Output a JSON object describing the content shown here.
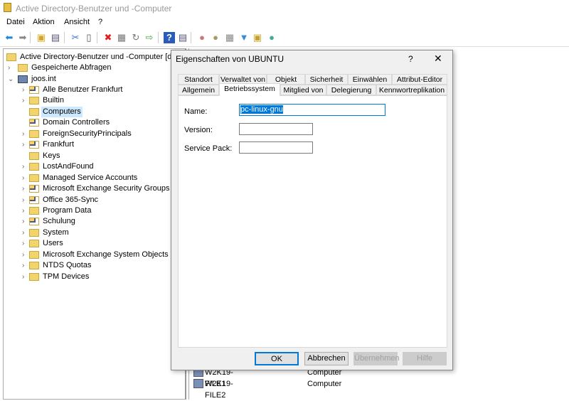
{
  "window": {
    "title": "Active Directory-Benutzer und -Computer"
  },
  "menu": [
    "Datei",
    "Aktion",
    "Ansicht",
    "?"
  ],
  "toolbar": {
    "icons": [
      "back-icon",
      "forward-icon",
      "up-folder-icon",
      "show-tree-icon",
      "cut-icon",
      "paste-icon",
      "delete-icon",
      "properties-icon",
      "refresh-icon",
      "export-icon",
      "help-icon",
      "console-icon",
      "new-user-icon",
      "new-group-icon",
      "new-ou-icon",
      "filter-icon",
      "add-to-group-icon",
      "delegate-icon"
    ]
  },
  "tree": {
    "root": "Active Directory-Benutzer und -Computer [dc0",
    "saved": "Gespeicherte Abfragen",
    "domain": "joos.int",
    "children": [
      {
        "label": "Alle Benutzer Frankfurt",
        "chev": true,
        "ou": true
      },
      {
        "label": "Builtin",
        "chev": true,
        "ou": false
      },
      {
        "label": "Computers",
        "chev": false,
        "ou": false,
        "selected": true
      },
      {
        "label": "Domain Controllers",
        "chev": false,
        "ou": true
      },
      {
        "label": "ForeignSecurityPrincipals",
        "chev": true,
        "ou": false
      },
      {
        "label": "Frankfurt",
        "chev": true,
        "ou": true
      },
      {
        "label": "Keys",
        "chev": false,
        "ou": false
      },
      {
        "label": "LostAndFound",
        "chev": true,
        "ou": false
      },
      {
        "label": "Managed Service Accounts",
        "chev": true,
        "ou": false
      },
      {
        "label": "Microsoft Exchange Security Groups",
        "chev": true,
        "ou": true
      },
      {
        "label": "Office 365-Sync",
        "chev": true,
        "ou": true
      },
      {
        "label": "Program Data",
        "chev": true,
        "ou": false
      },
      {
        "label": "Schulung",
        "chev": true,
        "ou": true
      },
      {
        "label": "System",
        "chev": true,
        "ou": false
      },
      {
        "label": "Users",
        "chev": true,
        "ou": false
      },
      {
        "label": "Microsoft Exchange System Objects",
        "chev": true,
        "ou": false
      },
      {
        "label": "NTDS Quotas",
        "chev": true,
        "ou": false
      },
      {
        "label": "TPM Devices",
        "chev": true,
        "ou": false
      }
    ]
  },
  "list": [
    {
      "name": "W2K19-FILE1",
      "type": "Computer"
    },
    {
      "name": "W2K19-FILE2",
      "type": "Computer"
    }
  ],
  "dialog": {
    "title": "Eigenschaften von UBUNTU",
    "help": "?",
    "close": "✕",
    "tabs_row1": [
      "Standort",
      "Verwaltet von",
      "Objekt",
      "Sicherheit",
      "Einwählen",
      "Attribut-Editor"
    ],
    "tabs_row2": [
      "Allgemein",
      "Betriebssystem",
      "Mitglied von",
      "Delegierung",
      "Kennwortreplikation"
    ],
    "active_tab": "Betriebssystem",
    "fields": {
      "name_label": "Name:",
      "name_value": "pc-linux-gnu",
      "version_label": "Version:",
      "version_value": "",
      "sp_label": "Service Pack:",
      "sp_value": ""
    },
    "buttons": {
      "ok": "OK",
      "cancel": "Abbrechen",
      "apply": "Übernehmen",
      "help": "Hilfe"
    }
  }
}
